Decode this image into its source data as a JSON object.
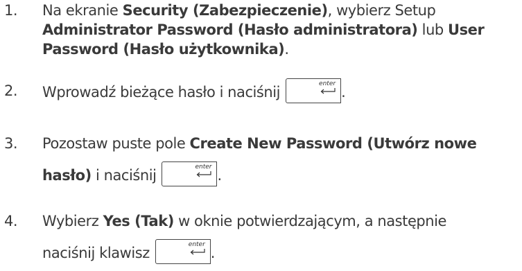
{
  "steps": [
    {
      "number": "1.",
      "lines": [
        [
          "Na ekranie ",
          "Security (Zabezpieczenie)",
          ", wybierz Setup"
        ],
        [
          "Administrator Password (Hasło administratora)",
          " lub ",
          "User"
        ],
        [
          "Password (Hasło użytkownika)",
          "."
        ]
      ]
    },
    {
      "number": "2.",
      "text": "Wprowadź bieżące hasło i naciśnij",
      "after": "."
    },
    {
      "number": "3.",
      "line1": [
        "Pozostaw puste pole ",
        "Create New Password (Utwórz nowe"
      ],
      "line2": [
        "hasło)",
        " i naciśnij"
      ],
      "after": "."
    },
    {
      "number": "4.",
      "line1": [
        "Wybierz ",
        "Yes (Tak)",
        " w oknie potwierdzającym, a następnie"
      ],
      "line2": "naciśnij klawisz",
      "after": "."
    }
  ],
  "key": {
    "label": "enter",
    "icon": "enter-arrow-icon"
  }
}
